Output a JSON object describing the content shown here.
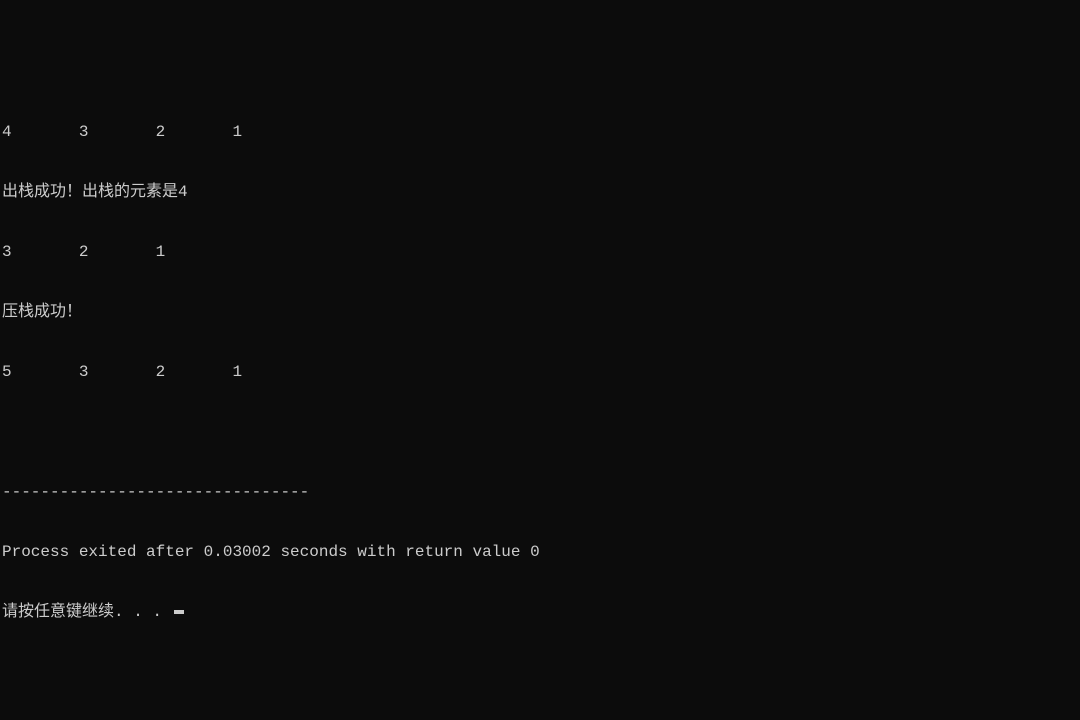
{
  "console": {
    "lines": [
      "4       3       2       1",
      "出栈成功！出栈的元素是4",
      "3       2       1",
      "压栈成功！",
      "5       3       2       1",
      "",
      "--------------------------------",
      "Process exited after 0.03002 seconds with return value 0",
      "请按任意键继续. . . "
    ]
  }
}
